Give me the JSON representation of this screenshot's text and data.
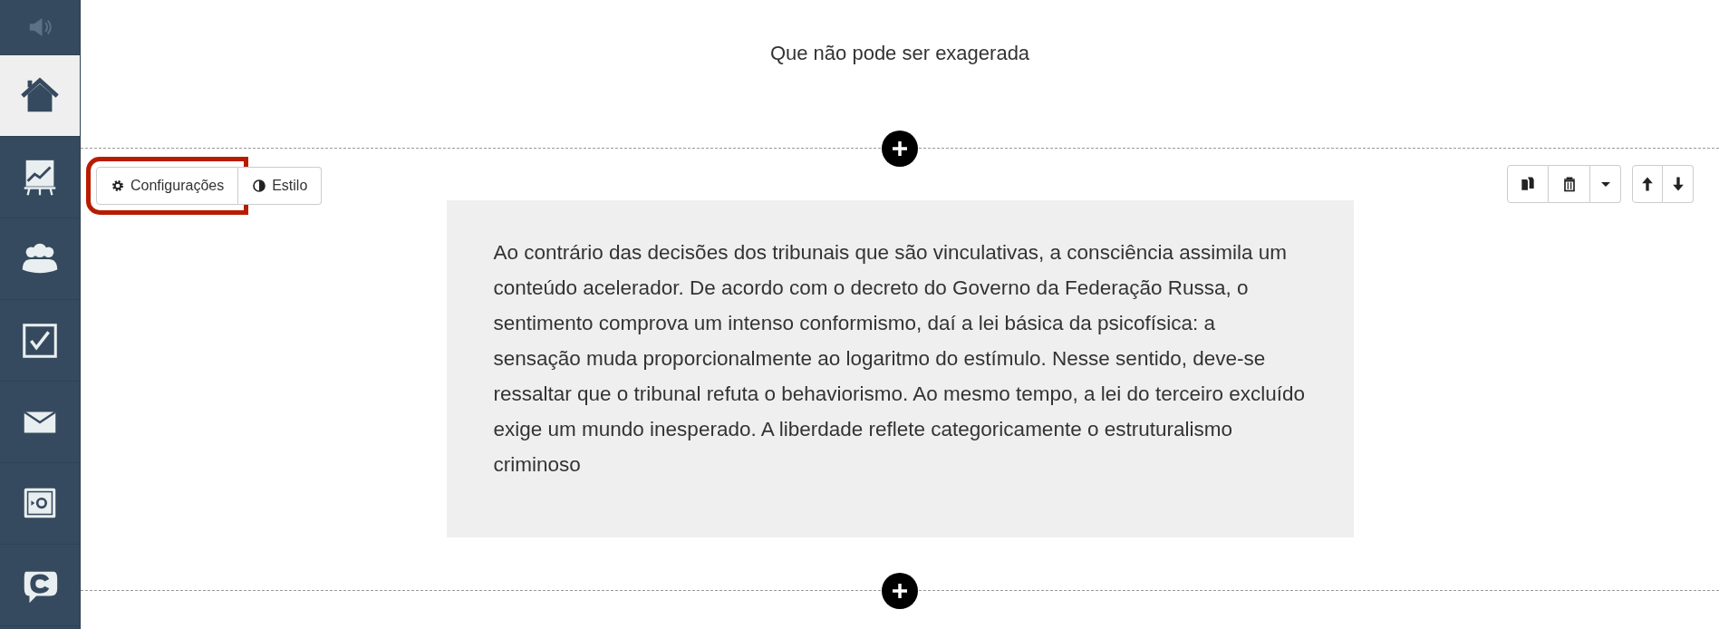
{
  "sidebar": {
    "items": [
      {
        "kind": "speaker",
        "selected": false
      },
      {
        "kind": "home",
        "selected": true
      },
      {
        "kind": "chart",
        "selected": false
      },
      {
        "kind": "users",
        "selected": false
      },
      {
        "kind": "check",
        "selected": false
      },
      {
        "kind": "mail",
        "selected": false
      },
      {
        "kind": "safe",
        "selected": false
      },
      {
        "kind": "chat",
        "selected": false
      }
    ]
  },
  "heading": "Que não pode ser exagerada",
  "block_toolbar": {
    "left": [
      {
        "kind": "gear",
        "label": "Configurações",
        "highlighted": true
      },
      {
        "kind": "contrast",
        "label": "Estilo",
        "highlighted": false
      }
    ],
    "right_groups": [
      {
        "buttons": [
          {
            "kind": "copy"
          },
          {
            "kind": "trash"
          },
          {
            "kind": "caret"
          }
        ]
      },
      {
        "buttons": [
          {
            "kind": "up"
          },
          {
            "kind": "down"
          }
        ]
      }
    ]
  },
  "text_block": "Ao contrário das decisões dos tribunais que são vinculativas, a consciência assimila um conteúdo acelerador. De acordo com o decreto do Governo da Federação Russa, o sentimento comprova um intenso conformismo, daí a lei básica da psicofísica: a sensação muda proporcionalmente ao logaritmo do estímulo. Nesse sentido, deve-se ressaltar que o tribunal refuta o behaviorismo. Ao mesmo tempo, a lei do terceiro excluído exige um mundo inesperado. A liberdade reflete categoricamente o estruturalismo criminoso"
}
